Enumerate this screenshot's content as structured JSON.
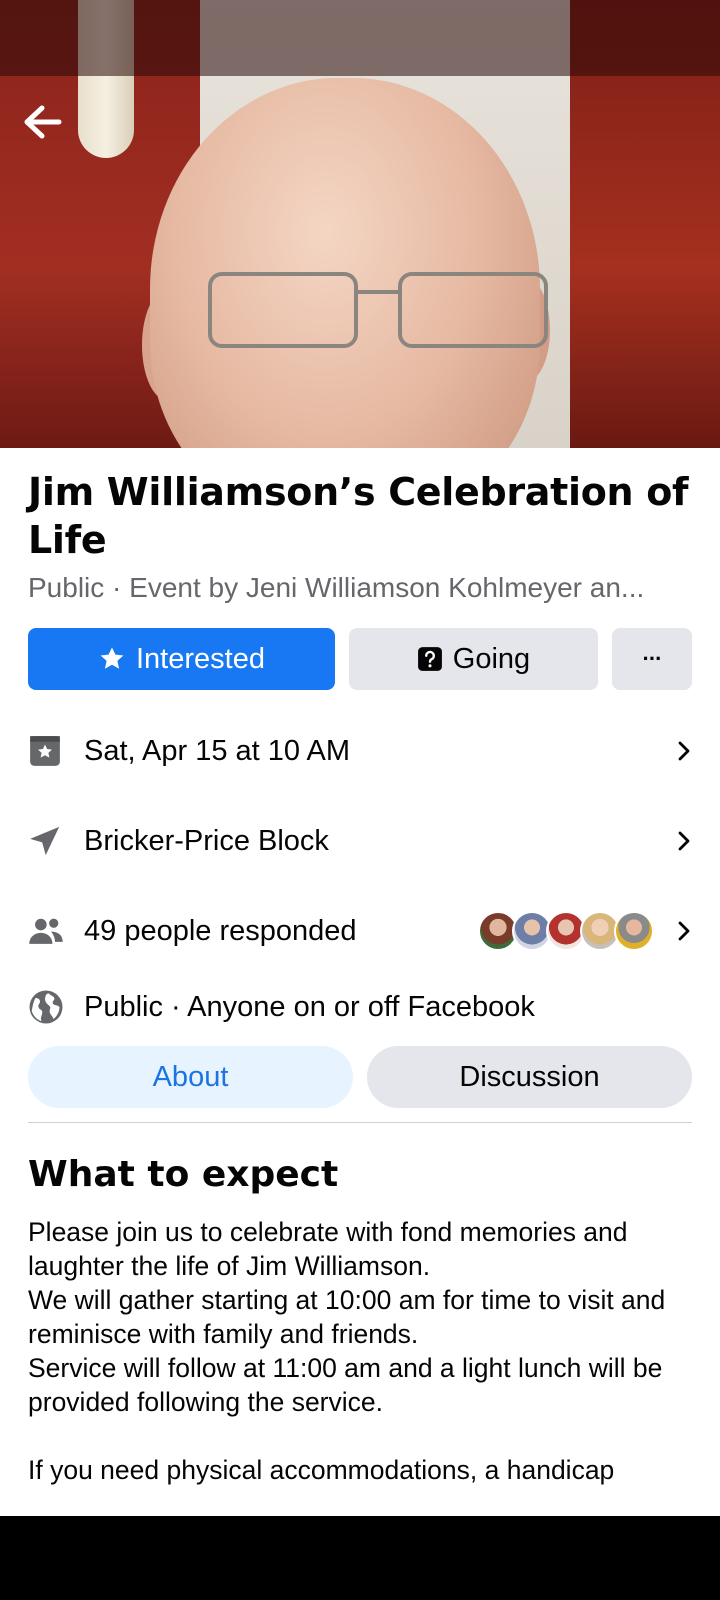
{
  "event": {
    "title": "Jim Williamson’s Celebration of Life",
    "subtitle": "Public · Event by Jeni Williamson Kohlmeyer an..."
  },
  "actions": {
    "interested_label": "Interested",
    "going_label": "Going",
    "more_label": "···"
  },
  "details": {
    "date": "Sat, Apr 15 at 10 AM",
    "location": "Bricker-Price Block",
    "responded": "49 people responded",
    "privacy": "Public · Anyone on or off Facebook"
  },
  "tabs": [
    {
      "label": "About",
      "active": true
    },
    {
      "label": "Discussion",
      "active": false
    }
  ],
  "about": {
    "heading": "What to expect",
    "lines": [
      "Please join us to celebrate with fond memories and laughter the life of Jim Williamson.",
      "We will gather starting at 10:00 am for time to visit and reminisce with family and friends.",
      "Service will follow at 11:00 am and a light lunch will be provided following the service.",
      "",
      "If you need physical accommodations, a handicap"
    ]
  },
  "colors": {
    "primary": "#1877f2",
    "secondary_bg": "#e4e6eb",
    "muted_text": "#65676b",
    "active_tab_bg": "#e7f3ff",
    "active_tab_text": "#1b74e4"
  },
  "icons": [
    "back-arrow-icon",
    "star-icon",
    "question-icon",
    "more-icon",
    "calendar-star-icon",
    "location-arrow-icon",
    "people-icon",
    "globe-icon",
    "chevron-right-icon"
  ]
}
